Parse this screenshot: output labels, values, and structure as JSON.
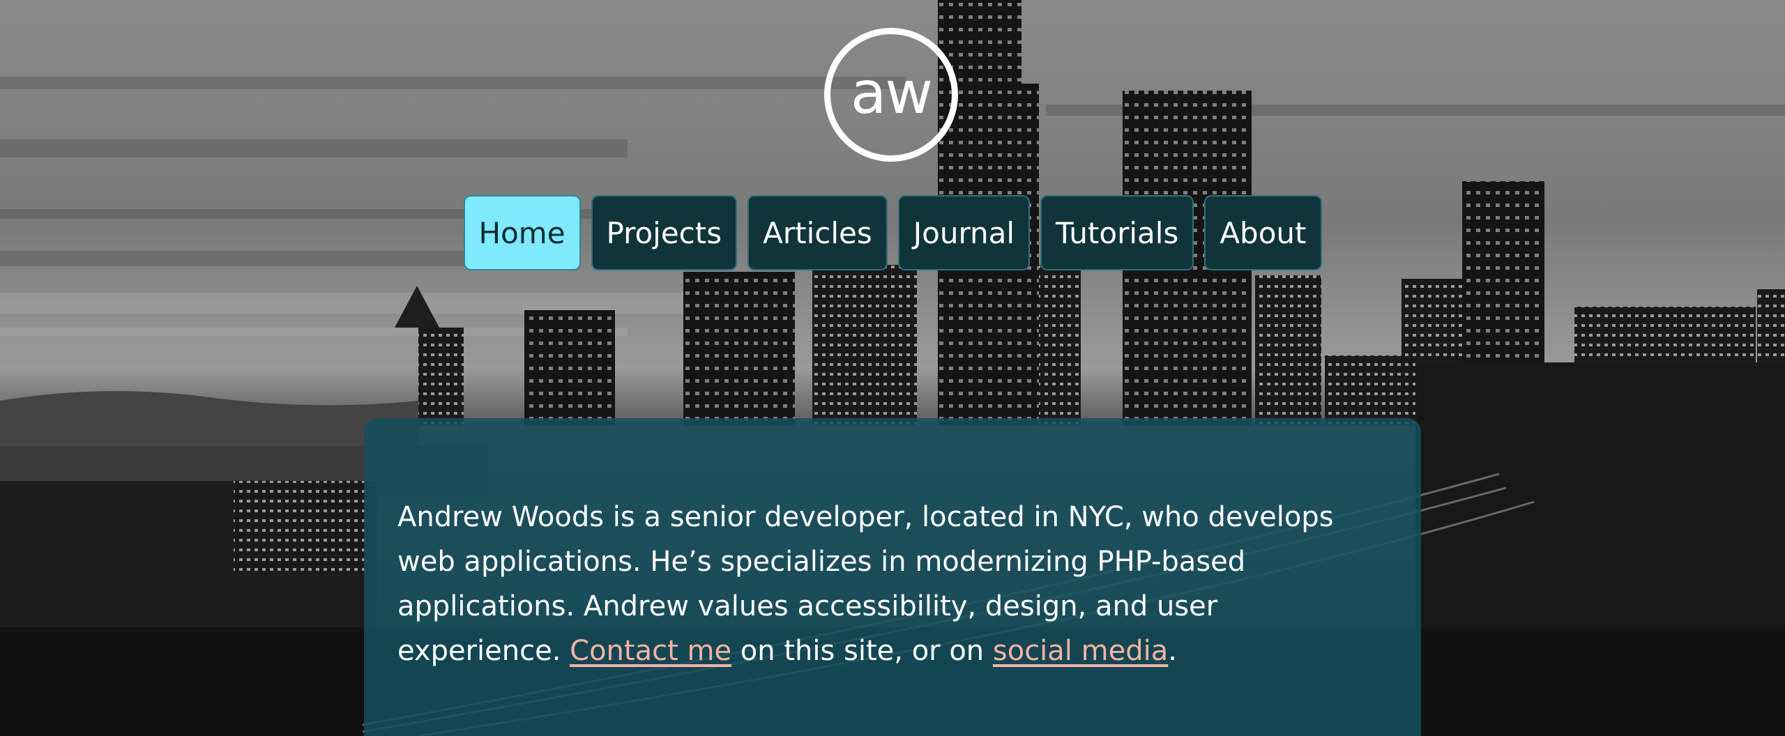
{
  "logo": {
    "text": "aw"
  },
  "nav": {
    "items": [
      {
        "label": "Home"
      },
      {
        "label": "Projects"
      },
      {
        "label": "Articles"
      },
      {
        "label": "Journal"
      },
      {
        "label": "Tutorials"
      },
      {
        "label": "About"
      }
    ],
    "active": "Home"
  },
  "intro": {
    "text_1": "Andrew Woods is a senior developer, located in NYC, who develops web applications. He’s specializes in modernizing PHP-based applications. Andrew values accessibility, design, and user experience. ",
    "contact_link": "Contact me",
    "text_2": " on this site, or on ",
    "social_link": "social media",
    "text_3": "."
  },
  "colors": {
    "nav_bg": "#11343b",
    "nav_active_bg": "#7eeafc",
    "panel_bg": "#144f5d",
    "link": "#f6b3a3"
  }
}
